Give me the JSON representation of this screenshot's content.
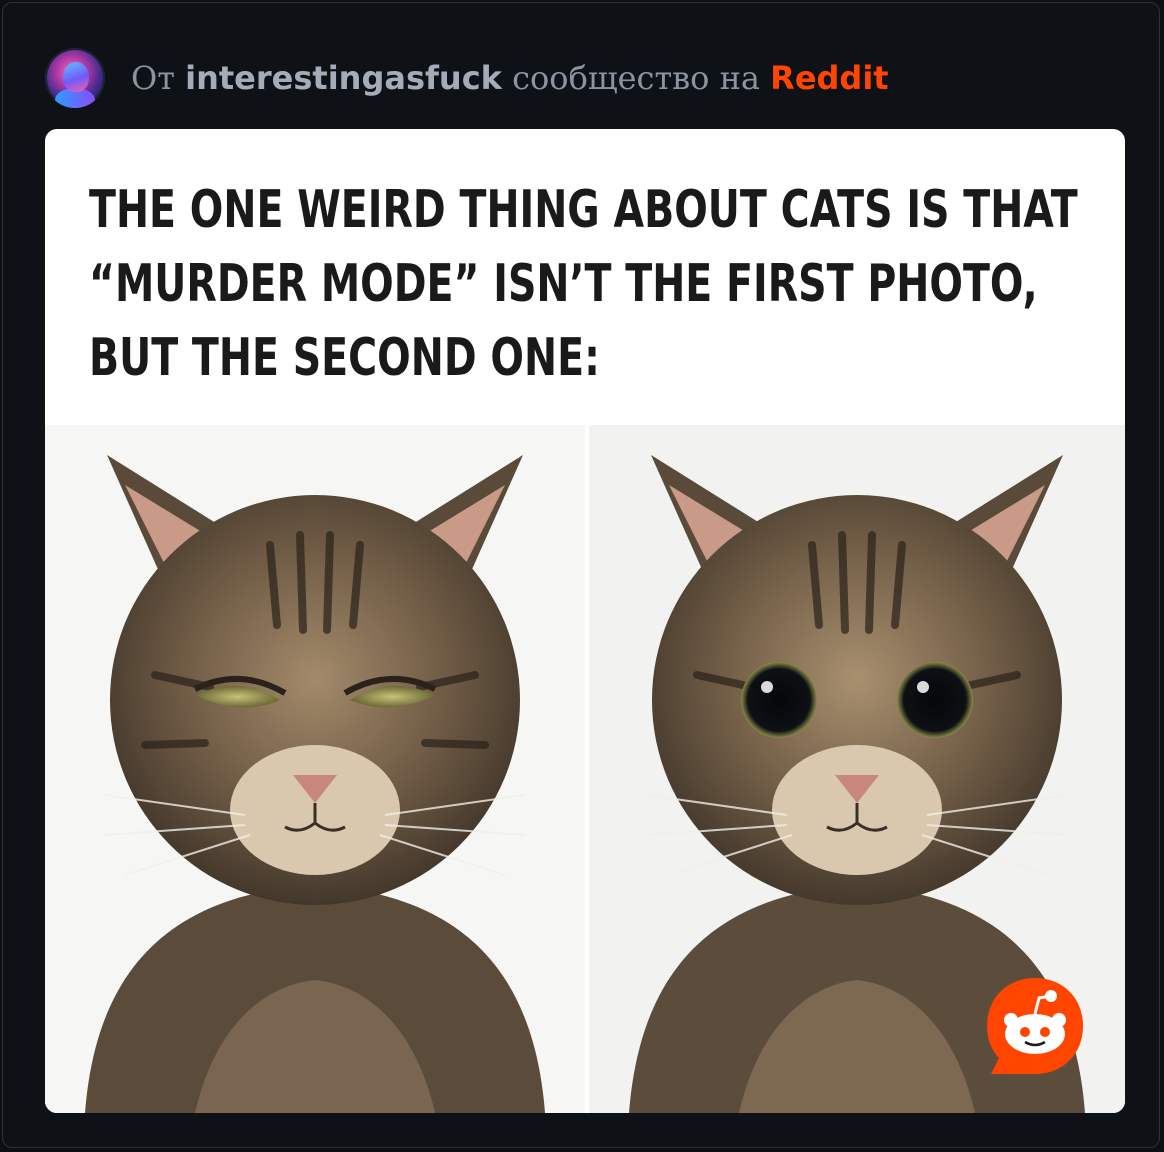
{
  "header": {
    "prefix": "От",
    "community": "interestingasfuck",
    "middle": "сообщество на",
    "platform": "Reddit"
  },
  "post": {
    "caption": "THE ONE WEIRD THING ABOUT CATS IS THAT “MURDER MODE” ISN’T THE FIRST PHOTO, BUT THE SECOND ONE:",
    "images": [
      {
        "icon": "cat-squinting-photo"
      },
      {
        "icon": "cat-wide-eyed-photo"
      }
    ]
  },
  "colors": {
    "background": "#0c0f14",
    "accent": "#ff4500",
    "muted_text": "#8b95a1"
  }
}
